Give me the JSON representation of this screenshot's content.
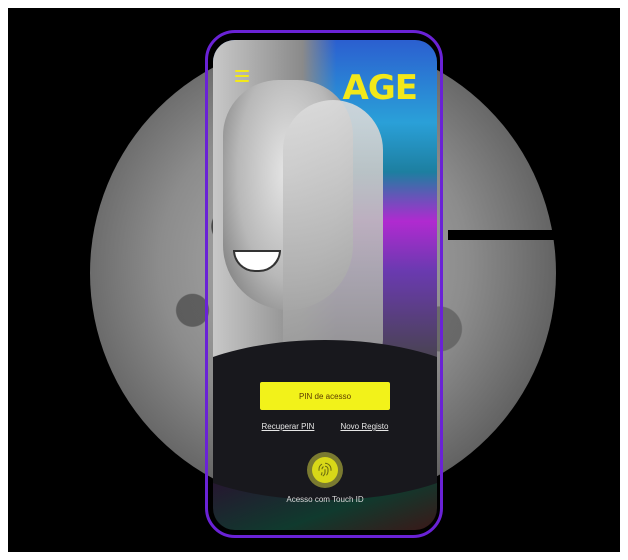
{
  "brand": {
    "logo_text": "AGE",
    "accent": "#f2e81a",
    "frame_color": "#6a22d6"
  },
  "header": {
    "menu_icon": "hamburger-icon"
  },
  "login": {
    "pin_button_label": "PIN de acesso",
    "recover_pin_label": "Recuperar PIN",
    "new_registration_label": "Novo Registo",
    "touch_id_label": "Acesso com Touch ID",
    "touch_id_icon": "fingerprint-icon"
  }
}
